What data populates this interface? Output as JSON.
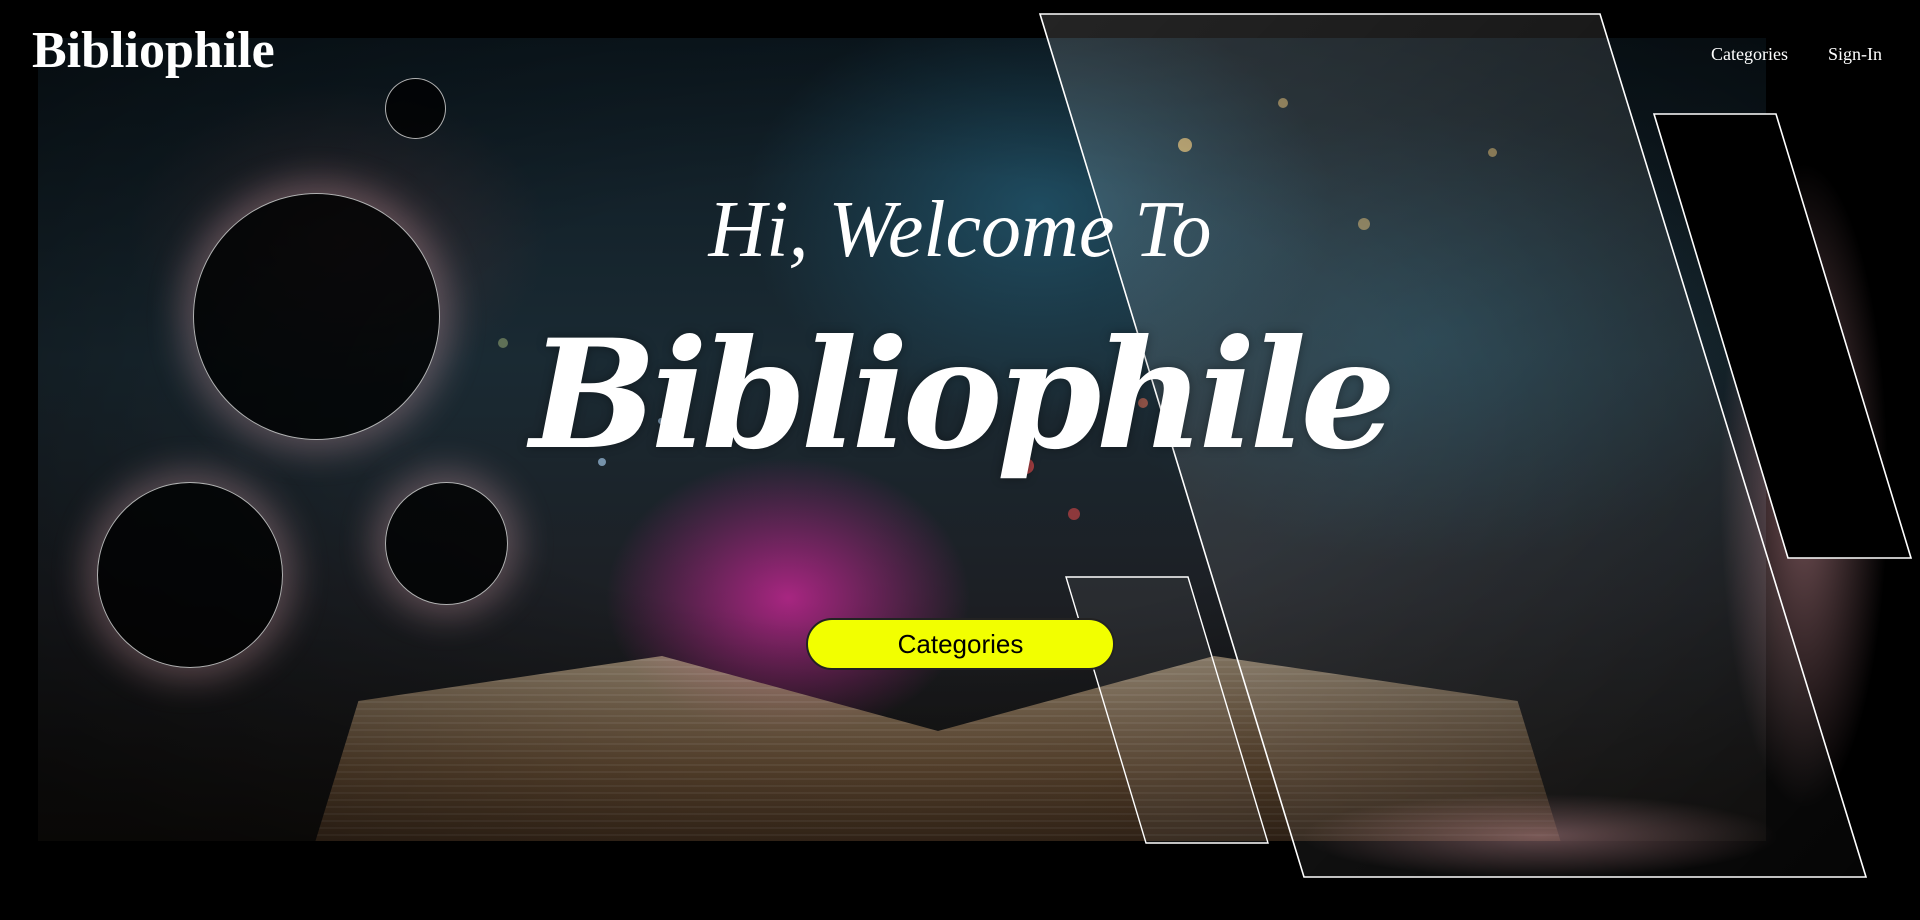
{
  "header": {
    "logo": "Bibliophile",
    "nav": [
      {
        "label": "Categories"
      },
      {
        "label": "Sign-In"
      }
    ]
  },
  "hero": {
    "greeting": "Hi, Welcome To",
    "title": "Bibliophile",
    "cta_label": "Categories"
  },
  "colors": {
    "cta_background": "#f2ff00",
    "page_background": "#000000",
    "text": "#ffffff"
  }
}
